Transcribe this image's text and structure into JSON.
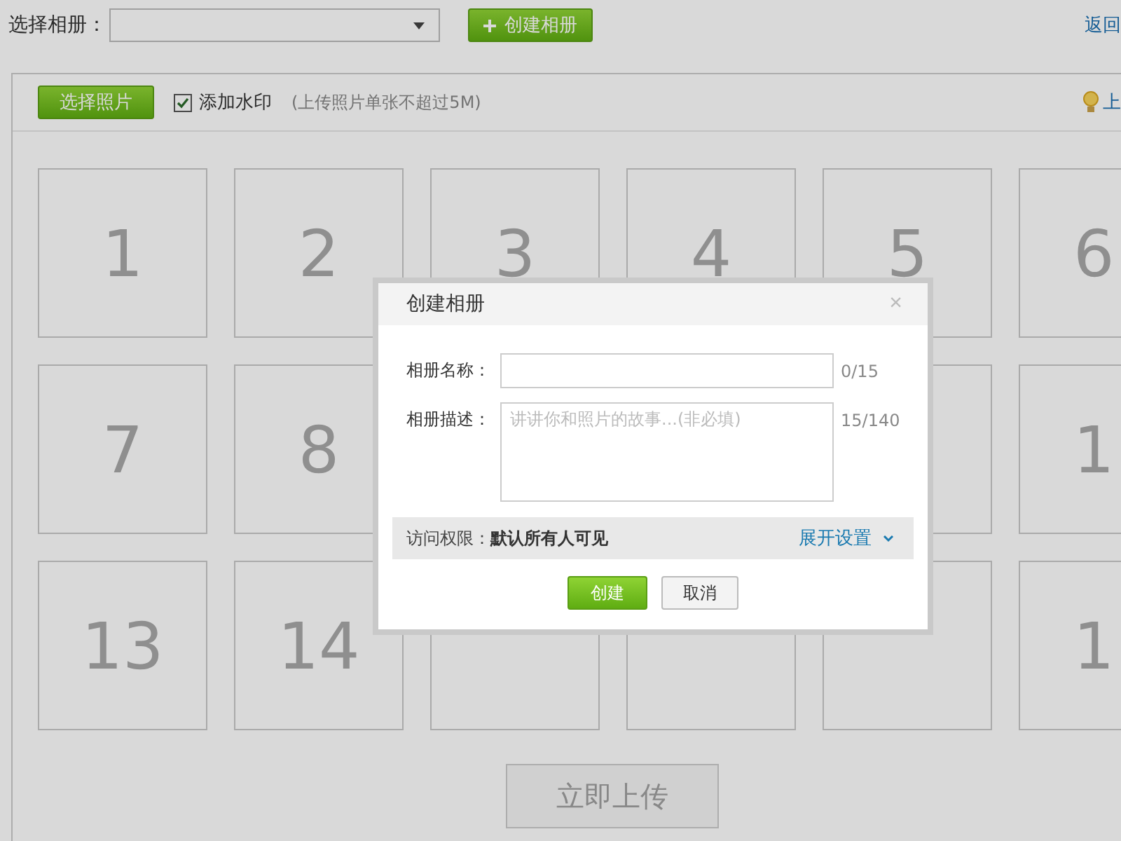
{
  "topbar": {
    "album_label": "选择相册：",
    "create_album_button": "创建相册",
    "back_link": "返回"
  },
  "toolbar": {
    "select_photos_button": "选择照片",
    "watermark": {
      "label": "添加水印",
      "checked": true
    },
    "size_hint": "(上传照片单张不超过5M)",
    "tip_text": "上"
  },
  "slots": [
    {
      "kind": "numbered",
      "label": "1"
    },
    {
      "kind": "numbered",
      "label": "2"
    },
    {
      "kind": "numbered",
      "label": "3"
    },
    {
      "kind": "numbered",
      "label": "4"
    },
    {
      "kind": "numbered",
      "label": "5"
    },
    {
      "kind": "numbered",
      "label": "6"
    },
    {
      "kind": "numbered",
      "label": "7"
    },
    {
      "kind": "numbered",
      "label": "8"
    },
    {
      "kind": "hidden"
    },
    {
      "kind": "hidden"
    },
    {
      "kind": "blank"
    },
    {
      "kind": "numbered",
      "label": "1"
    },
    {
      "kind": "numbered",
      "label": "13"
    },
    {
      "kind": "numbered",
      "label": "14"
    },
    {
      "kind": "blank"
    },
    {
      "kind": "blank"
    },
    {
      "kind": "blank"
    },
    {
      "kind": "numbered",
      "label": "1"
    }
  ],
  "upload_button": {
    "label": "立即上传",
    "disabled": true
  },
  "dialog": {
    "title": "创建相册",
    "close": "×",
    "name_field": {
      "label": "相册名称：",
      "count": "0/15"
    },
    "description_field": {
      "label": "相册描述：",
      "placeholder": "讲讲你和照片的故事...(非必填)",
      "count": "15/140"
    },
    "permission": {
      "label": "访问权限：",
      "value": "默认所有人可见",
      "expand_link": "展开设置"
    },
    "buttons": [
      {
        "label": "创建",
        "kind": "primary"
      },
      {
        "label": "取消",
        "kind": "secondary"
      }
    ]
  }
}
